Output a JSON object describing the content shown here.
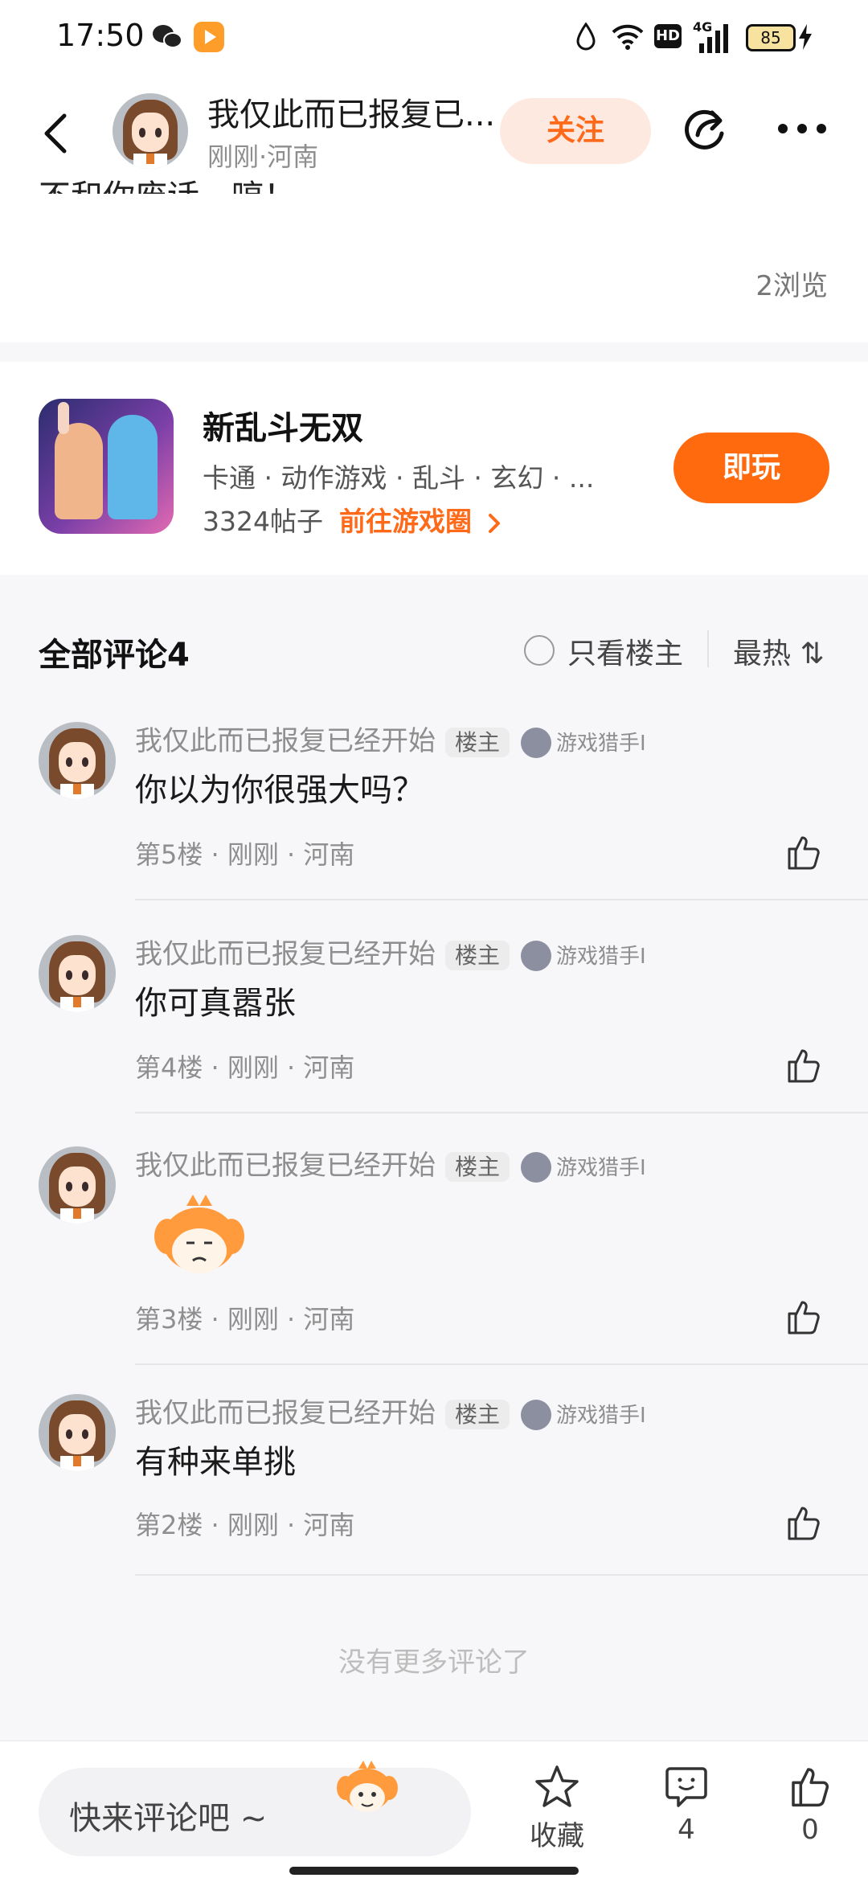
{
  "status_bar": {
    "time": "17:50",
    "icons": [
      "wechat-icon",
      "video-app-icon",
      "drop-icon",
      "wifi-icon",
      "hd-icon",
      "signal-4g-icon",
      "battery-icon",
      "charging-icon"
    ],
    "hd": "HD",
    "network": "4G",
    "battery": "85"
  },
  "header": {
    "username": "我仅此而已报复已...",
    "meta": "刚刚·河南",
    "follow_label": "关注"
  },
  "post": {
    "cut_text": "不和你废话，哼！",
    "views": "2浏览"
  },
  "game_card": {
    "title": "新乱斗无双",
    "tags": "卡通 · 动作游戏 · 乱斗 · 玄幻 · ...",
    "posts": "3324帖子",
    "circle_link": "前往游戏圈",
    "play_label": "即玩"
  },
  "comments_header": {
    "title": "全部评论4",
    "op_only": "只看楼主",
    "sort": "最热 ⇅"
  },
  "comments": [
    {
      "user": "我仅此而已报复已经开始",
      "badge": "楼主",
      "level": "游戏猎手I",
      "text": "你以为你很强大吗？",
      "meta": "第5楼 · 刚刚 · 河南"
    },
    {
      "user": "我仅此而已报复已经开始",
      "badge": "楼主",
      "level": "游戏猎手I",
      "text": "你可真嚣张",
      "meta": "第4楼 · 刚刚 · 河南"
    },
    {
      "user": "我仅此而已报复已经开始",
      "badge": "楼主",
      "level": "游戏猎手I",
      "text": "",
      "sticker": "mascot-sticker",
      "meta": "第3楼 · 刚刚 · 河南"
    },
    {
      "user": "我仅此而已报复已经开始",
      "badge": "楼主",
      "level": "游戏猎手I",
      "text": "有种来单挑",
      "meta": "第2楼 · 刚刚 · 河南"
    }
  ],
  "footer_note": "没有更多评论了",
  "bottom_bar": {
    "input_placeholder": "快来评论吧 ~",
    "favorite_label": "收藏",
    "comment_count": "4",
    "like_count": "0"
  },
  "colors": {
    "accent": "#ff6a1a",
    "follow_bg": "#fde9df"
  }
}
